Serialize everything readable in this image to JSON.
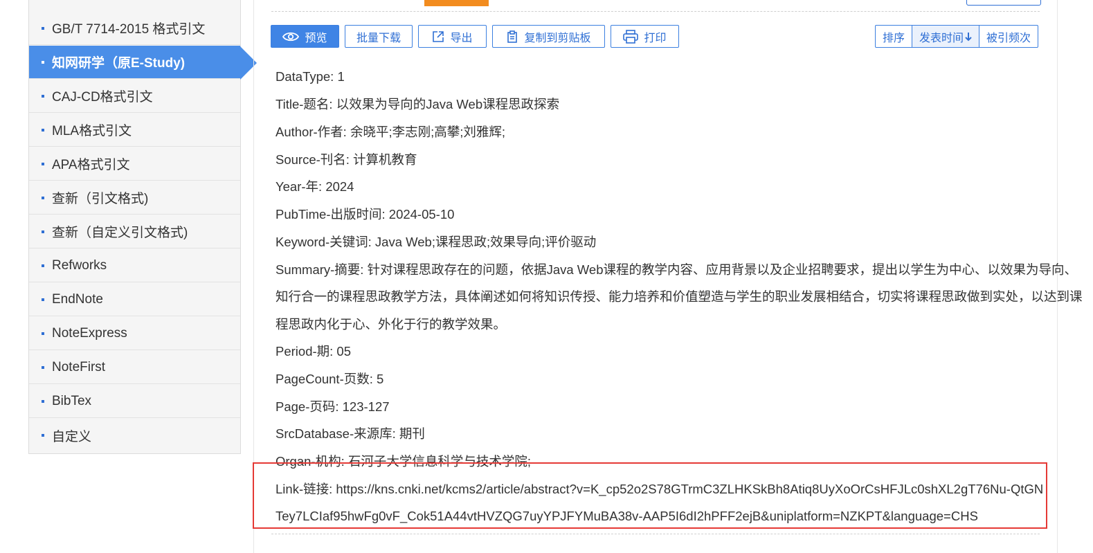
{
  "sidebar": {
    "items": [
      {
        "label": "GB/T 7714-2015 格式引文"
      },
      {
        "label": "知网研学（原E-Study)"
      },
      {
        "label": "CAJ-CD格式引文"
      },
      {
        "label": "MLA格式引文"
      },
      {
        "label": "APA格式引文"
      },
      {
        "label": "查新（引文格式)"
      },
      {
        "label": "查新（自定义引文格式)"
      },
      {
        "label": "Refworks"
      },
      {
        "label": "EndNote"
      },
      {
        "label": "NoteExpress"
      },
      {
        "label": "NoteFirst"
      },
      {
        "label": "BibTex"
      },
      {
        "label": "自定义"
      }
    ],
    "active_index": 1
  },
  "toolbar": {
    "preview": "预览",
    "batch_download": "批量下载",
    "export": "导出",
    "copy_clipboard": "复制到剪贴板",
    "print": "打印",
    "sort_label": "排序",
    "sort_pubtime": "发表时间",
    "sort_cited": "被引频次"
  },
  "record": {
    "datatype": "DataType: 1",
    "title": "Title-题名: 以效果为导向的Java Web课程思政探索",
    "author": "Author-作者: 余晓平;李志刚;高攀;刘雅辉;",
    "source": "Source-刊名: 计算机教育",
    "year": "Year-年: 2024",
    "pubtime": "PubTime-出版时间: 2024-05-10",
    "keyword": "Keyword-关键词: Java Web;课程思政;效果导向;评价驱动",
    "summary_1": "Summary-摘要: 针对课程思政存在的问题，依据Java Web课程的教学内容、应用背景以及企业招聘要求，提出以学生为中心、以效果为导向、",
    "summary_2": "知行合一的课程思政教学方法，具体阐述如何将知识传授、能力培养和价值塑造与学生的职业发展相结合，切实将课程思政做到实处，以达到课",
    "summary_3": "程思政内化于心、外化于行的教学效果。",
    "period": "Period-期: 05",
    "pagecount": "PageCount-页数: 5",
    "page": "Page-页码: 123-127",
    "srcdatabase": "SrcDatabase-来源库: 期刊",
    "organ": "Organ-机构: 石河子大学信息科学与技术学院;",
    "link_1": "Link-链接: https://kns.cnki.net/kcms2/article/abstract?v=K_cp52o2S78GTrmC3ZLHKSkBh8Atiq8UyXoOrCsHFJLc0shXL2gT76Nu-QtGN",
    "link_2": "Tey7LCIaf95hwFg0vF_Cok51A44vtHVZQG7uyYPJFYMuBA38v-AAP5I6dI2hPFF2ejB&uniplatform=NZKPT&language=CHS"
  },
  "colors": {
    "accent": "#3f84e5",
    "active_bg": "#4a8ee8",
    "highlight": "#e53935",
    "orange": "#f28c1f"
  }
}
